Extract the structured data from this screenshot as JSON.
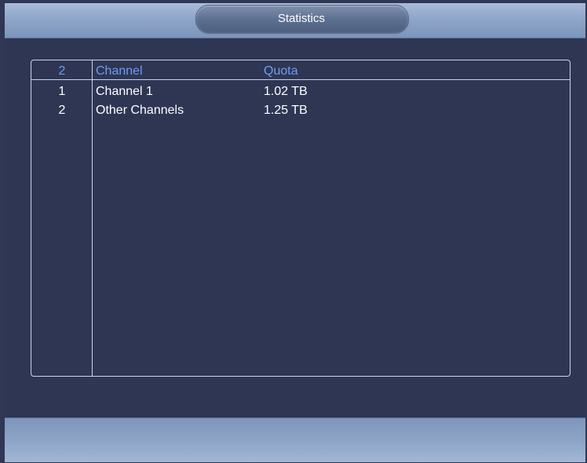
{
  "window": {
    "title": "Statistics"
  },
  "table": {
    "headers": {
      "count": "2",
      "channel": "Channel",
      "quota": "Quota"
    },
    "rows": [
      {
        "index": "1",
        "channel": "Channel 1",
        "quota": "1.02 TB"
      },
      {
        "index": "2",
        "channel": "Other Channels",
        "quota": "1.25 TB"
      }
    ]
  },
  "colors": {
    "background": "#2f3755",
    "header_text": "#6f9cf0",
    "row_text": "#ffffff",
    "title_bar": "#8fa6c8"
  }
}
